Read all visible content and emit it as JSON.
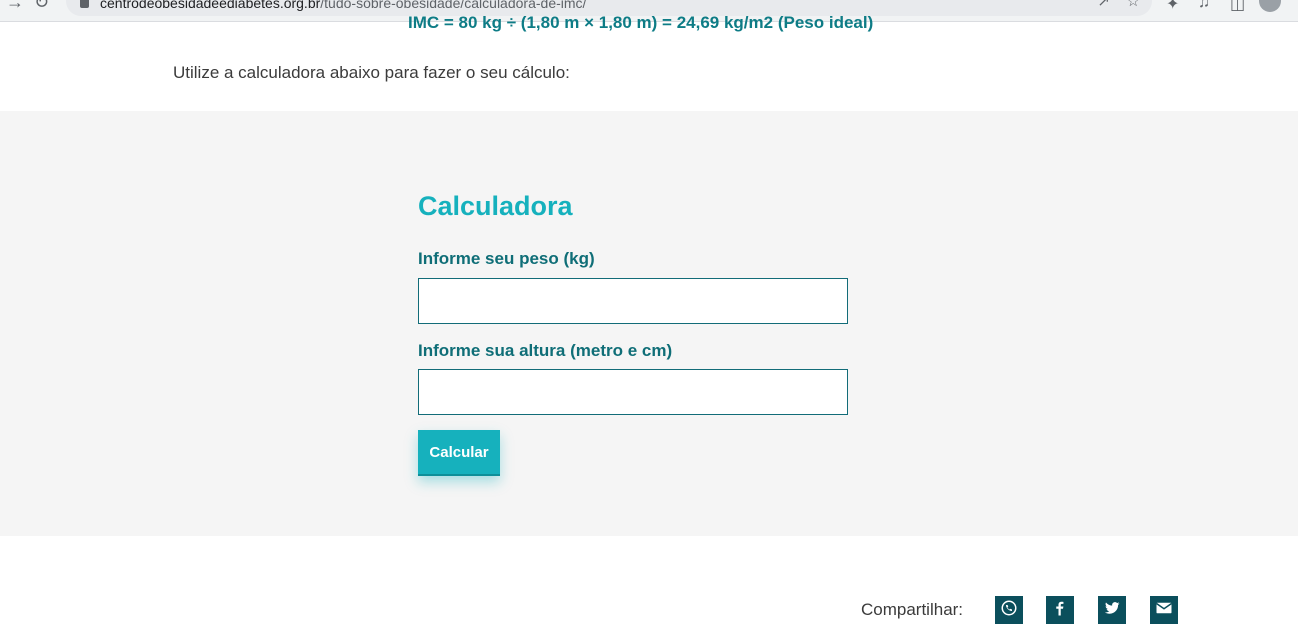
{
  "browser": {
    "url_host": "centrodeobesidadeediabetes.org.br",
    "url_path": "/tudo-sobre-obesidade/calculadora-de-imc/"
  },
  "article": {
    "formula": "IMC = 80 kg ÷ (1,80 m × 1,80 m) = 24,69 kg/m2 (Peso ideal)",
    "intro": "Utilize a calculadora abaixo para fazer o seu cálculo:"
  },
  "calculator": {
    "title": "Calculadora",
    "weight_label": "Informe seu peso (kg)",
    "weight_value": "",
    "height_label": "Informe sua altura (metro e cm)",
    "height_value": "",
    "button_label": "Calcular"
  },
  "share": {
    "label": "Compartilhar:",
    "icons": [
      "whatsapp-icon",
      "facebook-icon",
      "twitter-icon",
      "email-icon"
    ]
  },
  "colors": {
    "accent": "#16b1bd",
    "label": "#0f6e77",
    "section_bg": "#f5f5f5",
    "share_bg": "#0b4f5c"
  }
}
